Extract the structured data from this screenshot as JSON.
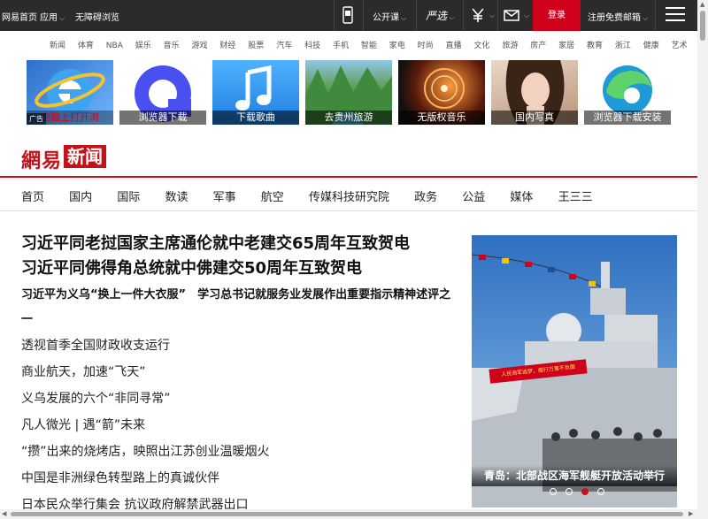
{
  "topbar": {
    "home": "网易首页",
    "apps": "应用",
    "accessible": "无障碍浏览",
    "open_course": "公开课",
    "yanxuan": "严选",
    "login": "登录",
    "register_mail": "注册免费邮箱"
  },
  "channels": [
    "新闻",
    "体育",
    "NBA",
    "娱乐",
    "音乐",
    "游戏",
    "财经",
    "股票",
    "汽车",
    "科技",
    "手机",
    "智能",
    "家电",
    "时尚",
    "直播",
    "文化",
    "旅游",
    "房产",
    "家居",
    "教育",
    "浙江",
    "健康",
    "艺术"
  ],
  "tiles": {
    "ad_tag": "广告",
    "items": [
      "电脑上打开浏",
      "浏览器下载",
      "下载歌曲",
      "去贵州旅游",
      "无版权音乐",
      "国内写真",
      "浏览器下载安装"
    ]
  },
  "logo": {
    "brand": "網易",
    "section": "新闻"
  },
  "nav": [
    "首页",
    "国内",
    "国际",
    "数读",
    "军事",
    "航空",
    "传媒科技研究院",
    "政务",
    "公益",
    "媒体",
    "王三三"
  ],
  "headlines": {
    "top": [
      "习近平同老挝国家主席通伦就中老建交65周年互致贺电",
      "习近平同佛得角总统就中佛建交50周年互致贺电"
    ],
    "sub": "习近平为义乌“换上一件大衣服”　学习总书记就服务业发展作出重要指示精神述评之一",
    "items": [
      "透视首季全国财政收支运行",
      "商业航天，加速“飞天”",
      "义乌发展的六个“非同寻常”",
      "凡人微光 | 遇“箭”未来",
      "“攒”出来的烧烤店，映照出江苏创业温暖烟火",
      "中国是非洲绿色转型路上的真诚伙伴",
      "日本民众举行集会 抗议政府解禁武器出口"
    ]
  },
  "feature": {
    "caption": "青岛：北部战区海军舰艇开放活动举行",
    "banner": "人民海军追梦，舰行万里不负国",
    "slides": 4,
    "active_slide": 3
  }
}
